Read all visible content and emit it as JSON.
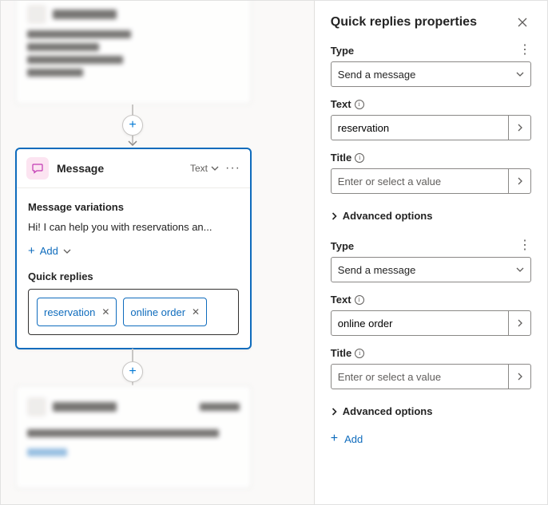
{
  "panel": {
    "title": "Quick replies properties",
    "replies": [
      {
        "type_label": "Type",
        "type_value": "Send a message",
        "text_label": "Text",
        "text_value": "reservation",
        "title_label": "Title",
        "title_placeholder": "Enter or select a value",
        "advanced_label": "Advanced options"
      },
      {
        "type_label": "Type",
        "type_value": "Send a message",
        "text_label": "Text",
        "text_value": "online order",
        "title_label": "Title",
        "title_placeholder": "Enter or select a value",
        "advanced_label": "Advanced options"
      }
    ],
    "add_label": "Add"
  },
  "message_card": {
    "title": "Message",
    "type_label": "Text",
    "variations_label": "Message variations",
    "variation_text": "Hi! I can help you with reservations an...",
    "add_label": "Add",
    "quick_replies_label": "Quick replies",
    "chips": [
      "reservation",
      "online order"
    ]
  }
}
